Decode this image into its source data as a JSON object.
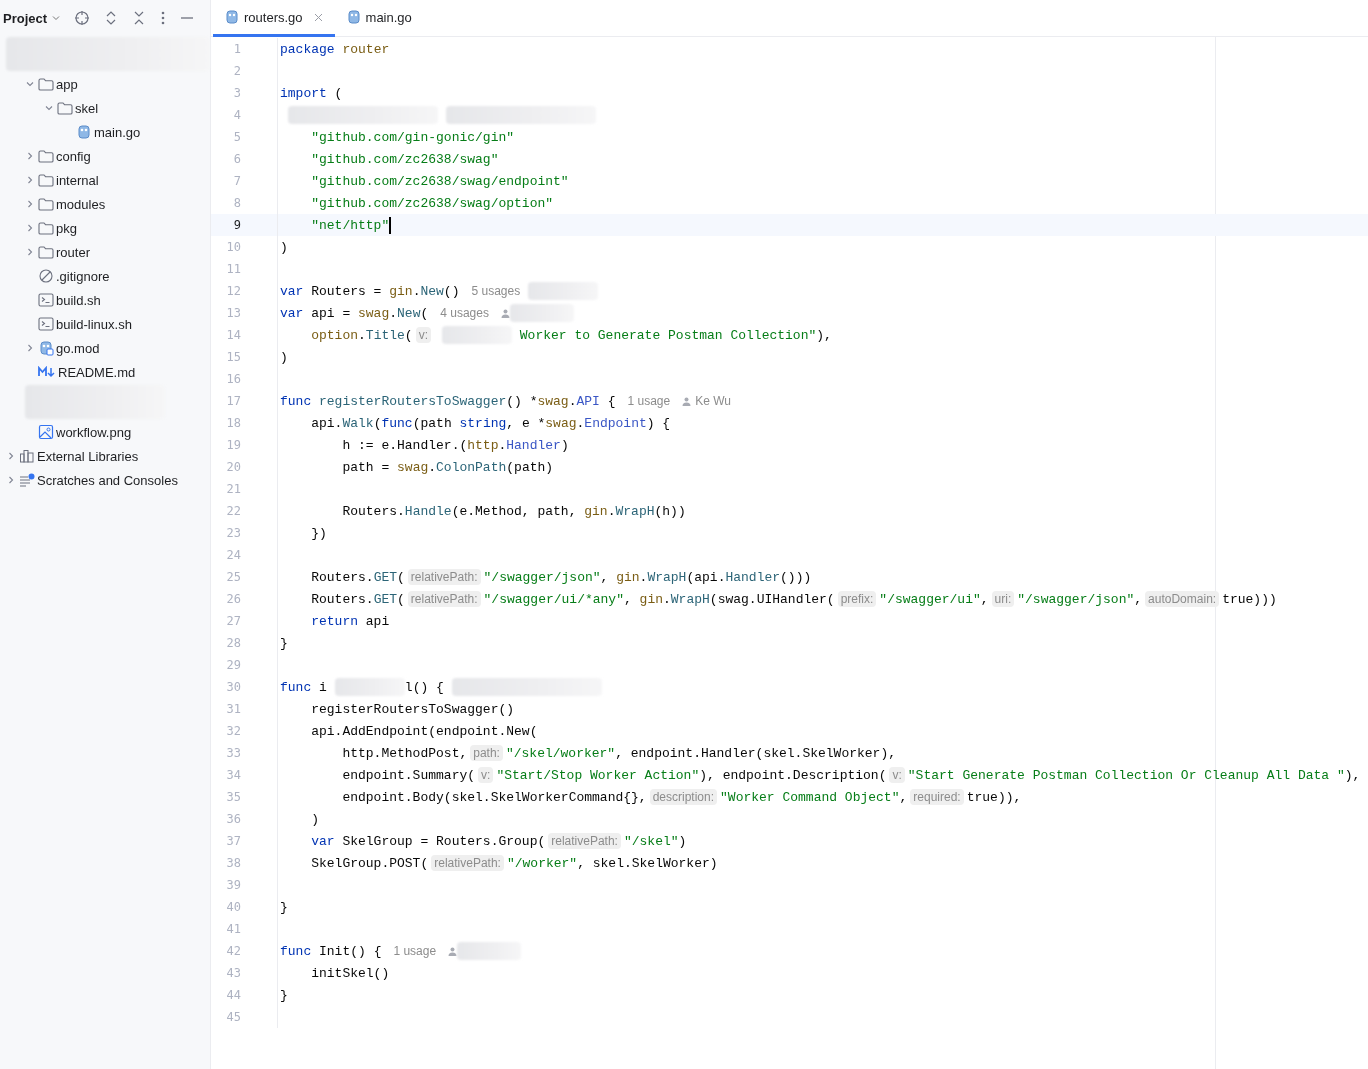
{
  "project_panel": {
    "title": "Project",
    "tree": [
      {
        "kind": "redacted",
        "children": [
          {
            "kind": "folder",
            "label": "app",
            "expanded": true,
            "children": [
              {
                "kind": "folder",
                "label": "skel",
                "expanded": true,
                "children": [
                  {
                    "kind": "go",
                    "label": "main.go"
                  }
                ]
              }
            ]
          },
          {
            "kind": "folder",
            "label": "config",
            "expanded": false
          },
          {
            "kind": "folder",
            "label": "internal",
            "expanded": false
          },
          {
            "kind": "folder",
            "label": "modules",
            "expanded": false
          },
          {
            "kind": "folder",
            "label": "pkg",
            "expanded": false
          },
          {
            "kind": "folder",
            "label": "router",
            "expanded": false
          },
          {
            "kind": "ignore",
            "label": ".gitignore"
          },
          {
            "kind": "shell",
            "label": "build.sh"
          },
          {
            "kind": "shell",
            "label": "build-linux.sh"
          },
          {
            "kind": "gomod",
            "label": "go.mod",
            "expanded": false
          },
          {
            "kind": "markdown",
            "label": "README.md"
          },
          {
            "kind": "redacted"
          },
          {
            "kind": "image",
            "label": "workflow.png"
          }
        ]
      },
      {
        "kind": "library",
        "label": "External Libraries",
        "expanded": false
      },
      {
        "kind": "scratch",
        "label": "Scratches and Consoles",
        "expanded": false
      }
    ]
  },
  "tabs": [
    {
      "label": "routers.go",
      "selected": true,
      "closable": true
    },
    {
      "label": "main.go",
      "selected": false,
      "closable": false
    }
  ],
  "editor": {
    "lines": [
      {
        "number": "1",
        "current": false,
        "parts": [
          {
            "kind": "code",
            "tokens": [
              {
                "kind": "keyword",
                "text": "package "
              },
              {
                "kind": "package",
                "text": "router"
              }
            ]
          }
        ]
      },
      {
        "number": "2",
        "current": false
      },
      {
        "number": "3",
        "current": false,
        "parts": [
          {
            "kind": "code",
            "tokens": [
              {
                "kind": "keyword",
                "text": "import"
              },
              {
                "kind": "plain",
                "text": " ("
              }
            ]
          }
        ]
      },
      {
        "number": "4",
        "current": false,
        "parts": [
          {
            "kind": "redacted",
            "wide": true
          },
          {
            "kind": "redacted",
            "wide": true
          }
        ]
      },
      {
        "number": "5",
        "current": false,
        "parts": [
          {
            "kind": "code",
            "tokens": [
              {
                "kind": "string",
                "text": "    \"github.com/gin-gonic/gin\""
              }
            ]
          }
        ]
      },
      {
        "number": "6",
        "current": false,
        "parts": [
          {
            "kind": "code",
            "tokens": [
              {
                "kind": "string",
                "text": "    \"github.com/zc2638/swag\""
              }
            ]
          }
        ]
      },
      {
        "number": "7",
        "current": false,
        "parts": [
          {
            "kind": "code",
            "tokens": [
              {
                "kind": "string",
                "text": "    \"github.com/zc2638/swag/endpoint\""
              }
            ]
          }
        ]
      },
      {
        "number": "8",
        "current": false,
        "parts": [
          {
            "kind": "code",
            "tokens": [
              {
                "kind": "string",
                "text": "    \"github.com/zc2638/swag/option\""
              }
            ]
          }
        ]
      },
      {
        "number": "9",
        "current": true,
        "parts": [
          {
            "kind": "code",
            "tokens": [
              {
                "kind": "string",
                "text": "    \"net/http\""
              }
            ]
          }
        ]
      },
      {
        "number": "10",
        "current": false,
        "parts": [
          {
            "kind": "code",
            "tokens": [
              {
                "kind": "plain",
                "text": ")"
              }
            ]
          }
        ]
      },
      {
        "number": "11",
        "current": false
      },
      {
        "number": "12",
        "current": false,
        "parts": [
          {
            "kind": "code",
            "tokens": [
              {
                "kind": "keyword",
                "text": "var"
              },
              {
                "kind": "plain",
                "text": " Routers = "
              },
              {
                "kind": "package",
                "text": "gin"
              },
              {
                "kind": "plain",
                "text": "."
              },
              {
                "kind": "method",
                "text": "New"
              },
              {
                "kind": "plain",
                "text": "()"
              }
            ]
          },
          {
            "kind": "usage",
            "text": "5 usages"
          },
          {
            "kind": "redacted",
            "wide": false
          }
        ]
      },
      {
        "number": "13",
        "current": false,
        "parts": [
          {
            "kind": "code",
            "tokens": [
              {
                "kind": "keyword",
                "text": "var"
              },
              {
                "kind": "plain",
                "text": " api = "
              },
              {
                "kind": "package",
                "text": "swag"
              },
              {
                "kind": "plain",
                "text": "."
              },
              {
                "kind": "method",
                "text": "New"
              },
              {
                "kind": "plain",
                "text": "("
              }
            ]
          },
          {
            "kind": "usage",
            "text": "4 usages"
          },
          {
            "kind": "author"
          }
        ]
      },
      {
        "number": "14",
        "current": false,
        "parts": [
          {
            "kind": "code",
            "tokens": [
              {
                "kind": "package",
                "text": "    option"
              },
              {
                "kind": "plain",
                "text": "."
              },
              {
                "kind": "method",
                "text": "Title"
              },
              {
                "kind": "plain",
                "text": "("
              }
            ]
          },
          {
            "kind": "hint",
            "text": "v:"
          },
          {
            "kind": "redacted",
            "wide": false
          },
          {
            "kind": "code",
            "tokens": [
              {
                "kind": "string",
                "text": " Worker to Generate Postman Collection\""
              },
              {
                "kind": "plain",
                "text": "),"
              }
            ]
          }
        ]
      },
      {
        "number": "15",
        "current": false,
        "parts": [
          {
            "kind": "code",
            "tokens": [
              {
                "kind": "plain",
                "text": ")"
              }
            ]
          }
        ]
      },
      {
        "number": "16",
        "current": false
      },
      {
        "number": "17",
        "current": false,
        "parts": [
          {
            "kind": "code",
            "tokens": [
              {
                "kind": "keyword",
                "text": "func "
              },
              {
                "kind": "method",
                "text": "registerRoutersToSwagger"
              },
              {
                "kind": "plain",
                "text": "() *"
              },
              {
                "kind": "package",
                "text": "swag"
              },
              {
                "kind": "plain",
                "text": "."
              },
              {
                "kind": "type",
                "text": "API"
              },
              {
                "kind": "plain",
                "text": " {"
              }
            ]
          },
          {
            "kind": "usage",
            "text": "1 usage"
          },
          {
            "kind": "author",
            "text": "Ke Wu"
          }
        ]
      },
      {
        "number": "18",
        "current": false,
        "parts": [
          {
            "kind": "code",
            "tokens": [
              {
                "kind": "plain",
                "text": "    api."
              },
              {
                "kind": "method",
                "text": "Walk"
              },
              {
                "kind": "plain",
                "text": "("
              },
              {
                "kind": "keyword",
                "text": "func"
              },
              {
                "kind": "plain",
                "text": "(path "
              },
              {
                "kind": "keyword",
                "text": "string"
              },
              {
                "kind": "plain",
                "text": ", e *"
              },
              {
                "kind": "package",
                "text": "swag"
              },
              {
                "kind": "plain",
                "text": "."
              },
              {
                "kind": "type",
                "text": "Endpoint"
              },
              {
                "kind": "plain",
                "text": ") {"
              }
            ]
          }
        ]
      },
      {
        "number": "19",
        "current": false,
        "parts": [
          {
            "kind": "code",
            "tokens": [
              {
                "kind": "plain",
                "text": "        h := e.Handler.("
              },
              {
                "kind": "package",
                "text": "http"
              },
              {
                "kind": "plain",
                "text": "."
              },
              {
                "kind": "type",
                "text": "Handler"
              },
              {
                "kind": "plain",
                "text": ")"
              }
            ]
          }
        ]
      },
      {
        "number": "20",
        "current": false,
        "parts": [
          {
            "kind": "code",
            "tokens": [
              {
                "kind": "plain",
                "text": "        path = "
              },
              {
                "kind": "package",
                "text": "swag"
              },
              {
                "kind": "plain",
                "text": "."
              },
              {
                "kind": "method",
                "text": "ColonPath"
              },
              {
                "kind": "plain",
                "text": "(path)"
              }
            ]
          }
        ]
      },
      {
        "number": "21",
        "current": false
      },
      {
        "number": "22",
        "current": false,
        "parts": [
          {
            "kind": "code",
            "tokens": [
              {
                "kind": "plain",
                "text": "        Routers."
              },
              {
                "kind": "method",
                "text": "Handle"
              },
              {
                "kind": "plain",
                "text": "(e.Method, path, "
              },
              {
                "kind": "package",
                "text": "gin"
              },
              {
                "kind": "plain",
                "text": "."
              },
              {
                "kind": "method",
                "text": "WrapH"
              },
              {
                "kind": "plain",
                "text": "(h))"
              }
            ]
          }
        ]
      },
      {
        "number": "23",
        "current": false,
        "parts": [
          {
            "kind": "code",
            "tokens": [
              {
                "kind": "plain",
                "text": "    })"
              }
            ]
          }
        ]
      },
      {
        "number": "24",
        "current": false
      },
      {
        "number": "25",
        "current": false,
        "parts": [
          {
            "kind": "code",
            "tokens": [
              {
                "kind": "plain",
                "text": "    Routers."
              },
              {
                "kind": "method",
                "text": "GET"
              },
              {
                "kind": "plain",
                "text": "("
              }
            ]
          },
          {
            "kind": "hint",
            "text": "relativePath:"
          },
          {
            "kind": "code",
            "tokens": [
              {
                "kind": "string",
                "text": "\"/swagger/json\""
              },
              {
                "kind": "plain",
                "text": ", "
              },
              {
                "kind": "package",
                "text": "gin"
              },
              {
                "kind": "plain",
                "text": "."
              },
              {
                "kind": "method",
                "text": "WrapH"
              },
              {
                "kind": "plain",
                "text": "(api."
              },
              {
                "kind": "method",
                "text": "Handler"
              },
              {
                "kind": "plain",
                "text": "()))"
              }
            ]
          }
        ]
      },
      {
        "number": "26",
        "current": false,
        "parts": [
          {
            "kind": "code",
            "tokens": [
              {
                "kind": "plain",
                "text": "    Routers."
              },
              {
                "kind": "method",
                "text": "GET"
              },
              {
                "kind": "plain",
                "text": "("
              }
            ]
          },
          {
            "kind": "hint",
            "text": "relativePath:"
          },
          {
            "kind": "code",
            "tokens": [
              {
                "kind": "string",
                "text": "\"/swagger/ui/*any\""
              },
              {
                "kind": "plain",
                "text": ", "
              },
              {
                "kind": "package",
                "text": "gin"
              },
              {
                "kind": "plain",
                "text": "."
              },
              {
                "kind": "method",
                "text": "WrapH"
              },
              {
                "kind": "plain",
                "text": "(swag.UIHandler("
              }
            ]
          },
          {
            "kind": "hint",
            "text": "prefix:"
          },
          {
            "kind": "code",
            "tokens": [
              {
                "kind": "string",
                "text": "\"/swagger/ui\""
              },
              {
                "kind": "plain",
                "text": ","
              }
            ]
          },
          {
            "kind": "hint",
            "text": "uri:"
          },
          {
            "kind": "code",
            "tokens": [
              {
                "kind": "string",
                "text": "\"/swagger/json\""
              },
              {
                "kind": "plain",
                "text": ","
              }
            ]
          },
          {
            "kind": "hint",
            "text": "autoDomain:"
          },
          {
            "kind": "code",
            "tokens": [
              {
                "kind": "plain",
                "text": "true)))"
              }
            ]
          }
        ]
      },
      {
        "number": "27",
        "current": false,
        "parts": [
          {
            "kind": "code",
            "tokens": [
              {
                "kind": "keyword",
                "text": "    return"
              },
              {
                "kind": "plain",
                "text": " api"
              }
            ]
          }
        ]
      },
      {
        "number": "28",
        "current": false,
        "parts": [
          {
            "kind": "code",
            "tokens": [
              {
                "kind": "plain",
                "text": "}"
              }
            ]
          }
        ]
      },
      {
        "number": "29",
        "current": false
      },
      {
        "number": "30",
        "current": false,
        "parts": [
          {
            "kind": "code",
            "tokens": [
              {
                "kind": "keyword",
                "text": "func"
              },
              {
                "kind": "plain",
                "text": " i"
              }
            ]
          },
          {
            "kind": "redacted",
            "wide": false
          },
          {
            "kind": "code",
            "tokens": [
              {
                "kind": "plain",
                "text": "l() {"
              }
            ]
          },
          {
            "kind": "redacted",
            "wide": true
          }
        ]
      },
      {
        "number": "31",
        "current": false,
        "parts": [
          {
            "kind": "code",
            "tokens": [
              {
                "kind": "plain",
                "text": "    registerRoutersToSwagger()"
              }
            ]
          }
        ]
      },
      {
        "number": "32",
        "current": false,
        "parts": [
          {
            "kind": "code",
            "tokens": [
              {
                "kind": "plain",
                "text": "    api.AddEndpoint(endpoint.New("
              }
            ]
          }
        ]
      },
      {
        "number": "33",
        "current": false,
        "parts": [
          {
            "kind": "code",
            "tokens": [
              {
                "kind": "plain",
                "text": "        http.MethodPost,"
              }
            ]
          },
          {
            "kind": "hint",
            "text": "path:"
          },
          {
            "kind": "code",
            "tokens": [
              {
                "kind": "string",
                "text": "\"/skel/worker\""
              },
              {
                "kind": "plain",
                "text": ", endpoint.Handler(skel.SkelWorker),"
              }
            ]
          }
        ]
      },
      {
        "number": "34",
        "current": false,
        "parts": [
          {
            "kind": "code",
            "tokens": [
              {
                "kind": "plain",
                "text": "        endpoint.Summary("
              }
            ]
          },
          {
            "kind": "hint",
            "text": "v:"
          },
          {
            "kind": "code",
            "tokens": [
              {
                "kind": "string",
                "text": "\"Start/Stop Worker Action\""
              },
              {
                "kind": "plain",
                "text": "), endpoint.Description("
              }
            ]
          },
          {
            "kind": "hint",
            "text": "v:"
          },
          {
            "kind": "code",
            "tokens": [
              {
                "kind": "string",
                "text": "\"Start Generate Postman Collection Or Cleanup All Data \""
              },
              {
                "kind": "plain",
                "text": "),"
              }
            ]
          }
        ]
      },
      {
        "number": "35",
        "current": false,
        "parts": [
          {
            "kind": "code",
            "tokens": [
              {
                "kind": "plain",
                "text": "        endpoint.Body(skel.SkelWorkerCommand{},"
              }
            ]
          },
          {
            "kind": "hint",
            "text": "description:"
          },
          {
            "kind": "code",
            "tokens": [
              {
                "kind": "string",
                "text": "\"Worker Command Object\""
              },
              {
                "kind": "plain",
                "text": ","
              }
            ]
          },
          {
            "kind": "hint",
            "text": "required:"
          },
          {
            "kind": "code",
            "tokens": [
              {
                "kind": "plain",
                "text": "true)),"
              }
            ]
          }
        ]
      },
      {
        "number": "36",
        "current": false,
        "parts": [
          {
            "kind": "code",
            "tokens": [
              {
                "kind": "plain",
                "text": "    )"
              }
            ]
          }
        ]
      },
      {
        "number": "37",
        "current": false,
        "parts": [
          {
            "kind": "code",
            "tokens": [
              {
                "kind": "keyword",
                "text": "    var"
              },
              {
                "kind": "plain",
                "text": " SkelGroup = Routers.Group("
              }
            ]
          },
          {
            "kind": "hint",
            "text": "relativePath:"
          },
          {
            "kind": "code",
            "tokens": [
              {
                "kind": "string",
                "text": "\"/skel\""
              },
              {
                "kind": "plain",
                "text": ")"
              }
            ]
          }
        ]
      },
      {
        "number": "38",
        "current": false,
        "parts": [
          {
            "kind": "code",
            "tokens": [
              {
                "kind": "plain",
                "text": "    SkelGroup.POST("
              }
            ]
          },
          {
            "kind": "hint",
            "text": "relativePath:"
          },
          {
            "kind": "code",
            "tokens": [
              {
                "kind": "string",
                "text": "\"/worker\""
              },
              {
                "kind": "plain",
                "text": ", skel.SkelWorker)"
              }
            ]
          }
        ]
      },
      {
        "number": "39",
        "current": false
      },
      {
        "number": "40",
        "current": false,
        "parts": [
          {
            "kind": "code",
            "tokens": [
              {
                "kind": "plain",
                "text": "}"
              }
            ]
          }
        ]
      },
      {
        "number": "41",
        "current": false
      },
      {
        "number": "42",
        "current": false,
        "parts": [
          {
            "kind": "code",
            "tokens": [
              {
                "kind": "keyword",
                "text": "func"
              },
              {
                "kind": "plain",
                "text": " Init() {"
              }
            ]
          },
          {
            "kind": "usage",
            "text": "1 usage"
          },
          {
            "kind": "author"
          }
        ]
      },
      {
        "number": "43",
        "current": false,
        "parts": [
          {
            "kind": "code",
            "tokens": [
              {
                "kind": "plain",
                "text": "    initSkel()"
              }
            ]
          }
        ]
      },
      {
        "number": "44",
        "current": false,
        "parts": [
          {
            "kind": "code",
            "tokens": [
              {
                "kind": "plain",
                "text": "}"
              }
            ]
          }
        ]
      },
      {
        "number": "45",
        "current": false
      }
    ]
  }
}
